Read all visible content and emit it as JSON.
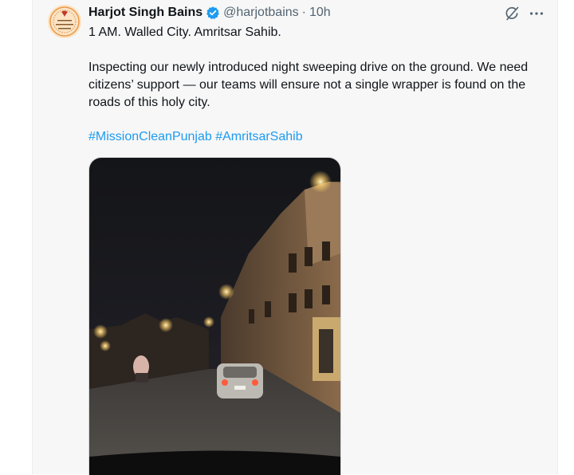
{
  "author": {
    "name": "Harjot Singh Bains",
    "handle": "@harjotbains",
    "separator": "·",
    "time": "10h",
    "verified_color": "#1d9bf0"
  },
  "tweet": {
    "line1": "1 AM. Walled City. Amritsar Sahib.",
    "body": "Inspecting our newly introduced night sweeping drive on the ground. We need citizens’ support — our teams will ensure not a single wrapper is found on the roads of this holy city.",
    "hashtags": [
      "#MissionCleanPunjab",
      "#AmritsarSahib"
    ]
  },
  "icons": {
    "verified": "verified-badge-icon",
    "grok": "grok-icon",
    "more": "more-options-icon"
  },
  "media": {
    "type": "video-still",
    "description_colors": {
      "sky": "#15161b",
      "street_lights": "#ffd27a"
    }
  },
  "colors": {
    "link": "#1d9bf0",
    "secondary_text": "#536471",
    "panel_bg": "#f7f7f7"
  }
}
